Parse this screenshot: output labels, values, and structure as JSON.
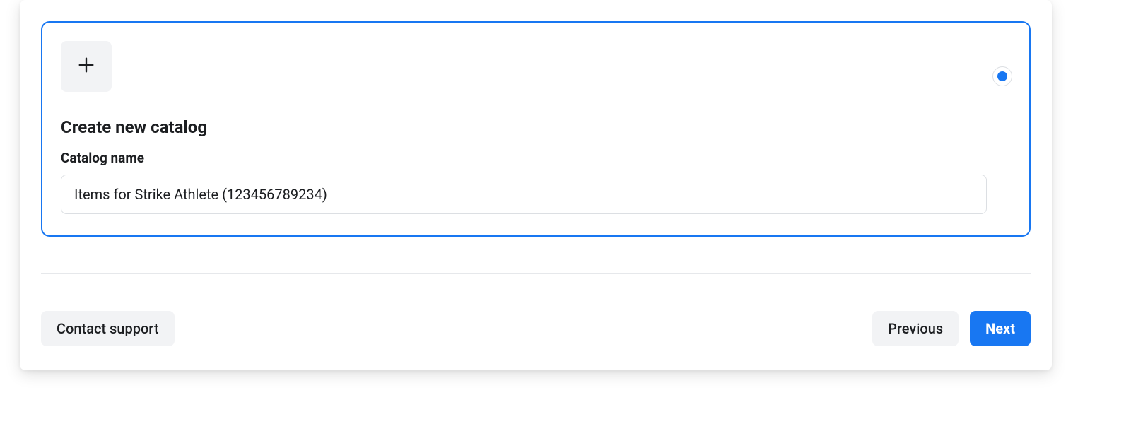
{
  "card": {
    "heading": "Create new catalog",
    "name_label": "Catalog name",
    "name_value": "Items for Strike Athlete (123456789234)",
    "selected": true
  },
  "footer": {
    "contact_label": "Contact support",
    "previous_label": "Previous",
    "next_label": "Next"
  },
  "colors": {
    "accent": "#1877f2",
    "surface_light": "#f2f3f5"
  }
}
